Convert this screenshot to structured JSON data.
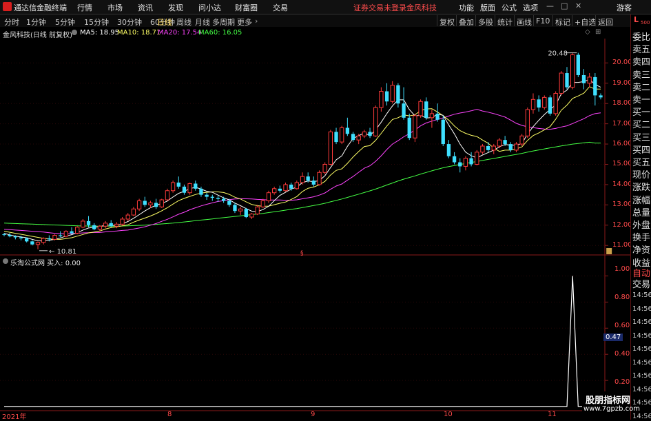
{
  "menubar": {
    "app_name": "通达信金融终端",
    "items": [
      "行情",
      "市场",
      "资讯",
      "发现",
      "问小达",
      "财富圈",
      "交易"
    ],
    "warning": "证券交易未登录",
    "company": "金风科技",
    "right_items": [
      "功能",
      "版面",
      "公式",
      "选项"
    ],
    "guest": "游客",
    "window_buttons": [
      "—",
      "□",
      "✕"
    ]
  },
  "periodbar": {
    "periods": [
      "分时",
      "1分钟",
      "5分钟",
      "15分钟",
      "30分钟",
      "60分钟",
      "日线",
      "周线",
      "月线",
      "多周期",
      "更多"
    ],
    "active": "日线",
    "tools": [
      "复权",
      "叠加",
      "多股",
      "统计",
      "画线",
      "F10",
      "标记",
      "+自选",
      "返回"
    ]
  },
  "chart_header": {
    "title": "金风科技(日线 前复权)",
    "ma5_label": "MA5: 18.95",
    "ma10_label": "MA10: 18.71",
    "ma20_label": "MA20: 17.54",
    "ma60_label": "MA60: 16.05",
    "colors": {
      "ma5": "#ffffff",
      "ma10": "#ffff66",
      "ma20": "#ff44ff",
      "ma60": "#44ff44"
    }
  },
  "indicator_header": {
    "title": "乐淘公式网 买入: 0.00"
  },
  "right_panel": {
    "top_tag": "L",
    "top_sub": "500",
    "items": [
      "委比",
      "卖五",
      "卖四",
      "卖三",
      "卖二",
      "卖一",
      "买一",
      "买二",
      "买三",
      "买四",
      "买五",
      "现价",
      "涨跌",
      "涨幅",
      "总量",
      "外盘",
      "换手",
      "净资",
      "收益"
    ],
    "bottom_items": [
      "自动",
      "交易"
    ],
    "times": [
      "14:56",
      "14:56",
      "14:56",
      "14:56",
      "14:56",
      "14:56",
      "14:56",
      "14:56",
      "14:56",
      "14:56"
    ]
  },
  "price_axis": [
    "20.00",
    "19.00",
    "18.00",
    "17.00",
    "16.00",
    "15.00",
    "14.00",
    "13.00",
    "12.00",
    "11.00"
  ],
  "indicator_axis": [
    "1.00",
    "0.80",
    "0.60",
    "0.47",
    "0.40",
    "0.20"
  ],
  "date_axis": [
    "2021年",
    "8",
    "9",
    "10",
    "11"
  ],
  "annotations": {
    "high": "20.48",
    "low": "10.81"
  },
  "watermark": {
    "line1": "股朋指标网",
    "line2": "www.7gpzb.com"
  },
  "chart_data": {
    "type": "candlestick",
    "title": "金风科技(日线 前复权)",
    "ylim": [
      10.6,
      21.2
    ],
    "indicator_ylim": [
      0,
      1.05
    ],
    "months_index": {
      "2021年": 0,
      "8": 38,
      "9": 72,
      "10": 101,
      "11": 119
    },
    "candles": [
      [
        11.55,
        11.62,
        11.45,
        11.52
      ],
      [
        11.52,
        11.62,
        11.4,
        11.45
      ],
      [
        11.45,
        11.5,
        11.3,
        11.4
      ],
      [
        11.4,
        11.48,
        11.25,
        11.35
      ],
      [
        11.35,
        11.4,
        11.15,
        11.2
      ],
      [
        11.2,
        11.25,
        11.0,
        11.05
      ],
      [
        11.05,
        11.2,
        10.81,
        11.15
      ],
      [
        11.15,
        11.4,
        11.05,
        11.35
      ],
      [
        11.35,
        11.5,
        11.2,
        11.3
      ],
      [
        11.3,
        11.55,
        11.25,
        11.5
      ],
      [
        11.5,
        11.7,
        11.4,
        11.45
      ],
      [
        11.45,
        11.75,
        11.4,
        11.7
      ],
      [
        11.7,
        11.9,
        11.55,
        11.6
      ],
      [
        11.6,
        11.95,
        11.55,
        11.9
      ],
      [
        11.9,
        12.3,
        11.85,
        12.2
      ],
      [
        12.2,
        12.45,
        11.9,
        12.0
      ],
      [
        12.0,
        12.1,
        11.75,
        11.8
      ],
      [
        11.8,
        12.0,
        11.7,
        11.95
      ],
      [
        11.95,
        12.2,
        11.85,
        12.1
      ],
      [
        12.1,
        12.25,
        11.9,
        11.95
      ],
      [
        11.95,
        12.15,
        11.85,
        12.05
      ],
      [
        12.05,
        12.4,
        12.0,
        12.3
      ],
      [
        12.3,
        12.6,
        12.2,
        12.5
      ],
      [
        12.5,
        12.9,
        12.45,
        12.8
      ],
      [
        12.8,
        13.3,
        12.7,
        13.2
      ],
      [
        13.2,
        13.4,
        12.9,
        13.0
      ],
      [
        13.0,
        13.2,
        12.85,
        13.1
      ],
      [
        13.1,
        13.3,
        12.8,
        12.9
      ],
      [
        12.9,
        13.3,
        12.85,
        13.25
      ],
      [
        13.25,
        13.8,
        13.2,
        13.7
      ],
      [
        13.7,
        14.2,
        13.6,
        14.1
      ],
      [
        14.1,
        14.4,
        13.8,
        13.9
      ],
      [
        13.9,
        14.0,
        13.5,
        13.6
      ],
      [
        13.6,
        14.1,
        13.5,
        14.05
      ],
      [
        14.05,
        14.2,
        13.7,
        13.8
      ],
      [
        13.8,
        13.9,
        13.4,
        13.5
      ],
      [
        13.5,
        13.6,
        13.25,
        13.4
      ],
      [
        13.4,
        13.5,
        13.2,
        13.35
      ],
      [
        13.35,
        13.45,
        13.15,
        13.3
      ],
      [
        13.3,
        13.4,
        13.1,
        13.2
      ],
      [
        13.2,
        13.3,
        12.9,
        13.0
      ],
      [
        13.0,
        13.1,
        12.6,
        12.7
      ],
      [
        12.7,
        12.9,
        12.5,
        12.8
      ],
      [
        12.8,
        12.85,
        12.35,
        12.4
      ],
      [
        12.4,
        12.6,
        12.3,
        12.55
      ],
      [
        12.55,
        13.0,
        12.5,
        12.9
      ],
      [
        12.9,
        13.3,
        12.85,
        13.2
      ],
      [
        13.2,
        13.7,
        13.1,
        13.6
      ],
      [
        13.6,
        13.9,
        13.5,
        13.8
      ],
      [
        13.8,
        13.95,
        13.6,
        13.7
      ],
      [
        13.7,
        14.1,
        13.65,
        14.0
      ],
      [
        14.0,
        14.1,
        13.7,
        13.8
      ],
      [
        13.8,
        14.2,
        13.75,
        14.1
      ],
      [
        14.1,
        14.6,
        14.0,
        14.4
      ],
      [
        14.4,
        14.6,
        14.1,
        14.2
      ],
      [
        14.2,
        14.4,
        13.9,
        14.0
      ],
      [
        14.0,
        14.7,
        13.95,
        14.6
      ],
      [
        14.6,
        15.1,
        14.5,
        15.0
      ],
      [
        15.0,
        16.7,
        14.95,
        16.6
      ],
      [
        16.6,
        16.8,
        16.0,
        16.1
      ],
      [
        16.1,
        16.9,
        16.0,
        16.8
      ],
      [
        16.8,
        17.3,
        16.4,
        16.5
      ],
      [
        16.5,
        16.6,
        16.1,
        16.2
      ],
      [
        16.2,
        16.5,
        16.0,
        16.4
      ],
      [
        16.4,
        16.7,
        16.3,
        16.6
      ],
      [
        16.6,
        16.8,
        16.3,
        16.4
      ],
      [
        16.4,
        17.9,
        16.35,
        17.8
      ],
      [
        17.8,
        18.8,
        17.6,
        18.6
      ],
      [
        18.6,
        19.0,
        17.9,
        18.1
      ],
      [
        18.1,
        19.1,
        18.0,
        18.9
      ],
      [
        18.9,
        19.0,
        17.8,
        18.0
      ],
      [
        18.0,
        18.8,
        17.2,
        17.3
      ],
      [
        17.3,
        17.5,
        16.2,
        16.3
      ],
      [
        16.3,
        17.5,
        16.1,
        17.4
      ],
      [
        17.4,
        18.2,
        17.3,
        18.1
      ],
      [
        18.1,
        18.3,
        17.2,
        17.3
      ],
      [
        17.3,
        17.7,
        16.8,
        17.5
      ],
      [
        17.5,
        18.0,
        17.1,
        17.2
      ],
      [
        17.2,
        17.4,
        15.9,
        16.0
      ],
      [
        16.0,
        16.2,
        15.3,
        15.4
      ],
      [
        15.4,
        15.6,
        15.0,
        15.1
      ],
      [
        15.1,
        15.3,
        14.6,
        14.9
      ],
      [
        14.9,
        15.4,
        14.7,
        15.3
      ],
      [
        15.3,
        15.6,
        14.9,
        15.0
      ],
      [
        15.0,
        15.7,
        14.95,
        15.6
      ],
      [
        15.6,
        16.0,
        15.5,
        15.9
      ],
      [
        15.9,
        16.1,
        15.6,
        15.7
      ],
      [
        15.7,
        16.0,
        15.5,
        15.9
      ],
      [
        15.9,
        16.3,
        15.8,
        16.2
      ],
      [
        16.2,
        16.4,
        15.9,
        16.0
      ],
      [
        16.0,
        16.1,
        15.6,
        15.7
      ],
      [
        15.7,
        16.1,
        15.6,
        16.0
      ],
      [
        16.0,
        16.5,
        15.9,
        16.4
      ],
      [
        16.4,
        17.8,
        16.3,
        17.7
      ],
      [
        17.7,
        18.5,
        17.5,
        18.2
      ],
      [
        18.2,
        18.4,
        17.6,
        17.8
      ],
      [
        17.8,
        18.4,
        17.7,
        18.3
      ],
      [
        18.3,
        18.4,
        17.4,
        17.5
      ],
      [
        17.5,
        18.6,
        17.4,
        18.5
      ],
      [
        18.5,
        19.6,
        18.4,
        19.5
      ],
      [
        19.5,
        19.8,
        18.7,
        18.8
      ],
      [
        18.8,
        20.48,
        18.7,
        20.4
      ],
      [
        20.4,
        20.5,
        19.3,
        19.4
      ],
      [
        19.4,
        19.7,
        18.7,
        19.0
      ],
      [
        19.0,
        19.5,
        18.8,
        19.3
      ],
      [
        19.3,
        19.5,
        17.9,
        18.4
      ],
      [
        18.4,
        18.5,
        18.2,
        18.3
      ]
    ],
    "ma5": [
      11.6,
      11.52,
      11.46,
      11.42,
      11.38,
      11.3,
      11.23,
      11.22,
      11.26,
      11.3,
      11.37,
      11.46,
      11.53,
      11.63,
      11.76,
      11.86,
      11.9,
      11.93,
      12.0,
      12.0,
      11.98,
      12.07,
      12.18,
      12.34,
      12.52,
      12.7,
      12.86,
      12.98,
      13.07,
      13.19,
      13.39,
      13.57,
      13.67,
      13.8,
      13.87,
      13.78,
      13.67,
      13.62,
      13.48,
      13.35,
      13.25,
      13.09,
      12.96,
      12.82,
      12.69,
      12.67,
      12.77,
      12.93,
      13.21,
      13.47,
      13.62,
      13.78,
      13.88,
      14.1,
      14.18,
      14.14,
      14.2,
      14.44,
      14.84,
      15.22,
      15.42,
      15.89,
      16.27,
      16.42,
      16.54,
      16.42,
      16.7,
      17.08,
      17.5,
      17.88,
      18.18,
      18.18,
      17.7,
      17.39,
      17.42,
      17.28,
      17.31,
      17.47,
      17.42,
      16.94,
      16.5,
      16.0,
      15.6,
      15.42,
      15.32,
      15.46,
      15.58,
      15.7,
      15.86,
      15.98,
      15.94,
      15.95,
      16.02,
      16.5,
      16.86,
      17.17,
      17.46,
      17.7,
      17.94,
      18.48,
      18.66,
      19.04,
      19.04,
      19.08,
      19.18,
      18.94,
      18.8
    ],
    "ma10": [
      11.7,
      11.65,
      11.6,
      11.55,
      11.5,
      11.45,
      11.4,
      11.35,
      11.32,
      11.3,
      11.3,
      11.34,
      11.38,
      11.46,
      11.54,
      11.62,
      11.66,
      11.71,
      11.81,
      11.88,
      11.92,
      11.97,
      12.02,
      12.15,
      12.25,
      12.35,
      12.45,
      12.57,
      12.71,
      12.86,
      13.04,
      13.21,
      13.32,
      13.42,
      13.51,
      13.58,
      13.62,
      13.64,
      13.64,
      13.61,
      13.52,
      13.38,
      13.29,
      13.15,
      13.02,
      12.96,
      12.93,
      12.94,
      13.01,
      13.08,
      13.14,
      13.27,
      13.41,
      13.66,
      13.82,
      13.88,
      13.99,
      14.16,
      14.47,
      14.7,
      14.78,
      15.05,
      15.36,
      15.63,
      15.88,
      15.92,
      16.18,
      16.53,
      16.89,
      17.21,
      17.3,
      17.44,
      17.39,
      17.44,
      17.65,
      17.73,
      17.74,
      17.58,
      17.4,
      17.18,
      16.89,
      16.66,
      16.53,
      16.43,
      16.37,
      16.2,
      16.04,
      15.8,
      15.64,
      15.7,
      15.7,
      15.76,
      15.86,
      16.18,
      16.42,
      16.55,
      16.7,
      16.86,
      17.22,
      17.67,
      17.92,
      18.25,
      18.37,
      18.51,
      18.83,
      18.71,
      18.71
    ],
    "ma20": [
      11.8,
      11.78,
      11.76,
      11.74,
      11.72,
      11.7,
      11.68,
      11.66,
      11.63,
      11.6,
      11.58,
      11.58,
      11.58,
      11.6,
      11.62,
      11.63,
      11.64,
      11.64,
      11.67,
      11.69,
      11.71,
      11.74,
      11.76,
      11.81,
      11.86,
      11.92,
      12.0,
      12.08,
      12.19,
      12.29,
      12.41,
      12.54,
      12.64,
      12.76,
      12.86,
      12.95,
      13.03,
      13.1,
      13.17,
      13.21,
      13.26,
      13.29,
      13.3,
      13.3,
      13.29,
      13.27,
      13.26,
      13.24,
      13.24,
      13.24,
      13.23,
      13.23,
      13.25,
      13.3,
      13.35,
      13.4,
      13.48,
      13.59,
      13.77,
      13.93,
      14.03,
      14.22,
      14.4,
      14.61,
      14.81,
      14.93,
      15.15,
      15.42,
      15.73,
      16.0,
      16.17,
      16.36,
      16.51,
      16.69,
      16.9,
      17.04,
      17.13,
      17.21,
      17.29,
      17.38,
      17.47,
      17.53,
      17.58,
      17.64,
      17.71,
      17.63,
      17.57,
      17.5,
      17.42,
      17.33,
      17.18,
      17.02,
      16.92,
      16.85,
      16.81,
      16.77,
      16.74,
      16.73,
      16.77,
      16.84,
      16.9,
      17.01,
      17.13,
      17.25,
      17.4,
      17.5,
      17.54
    ],
    "ma60": [
      12.1,
      12.09,
      12.08,
      12.07,
      12.06,
      12.05,
      12.04,
      12.03,
      12.02,
      12.01,
      12.0,
      11.99,
      11.98,
      11.97,
      11.96,
      11.96,
      11.95,
      11.95,
      11.95,
      11.95,
      11.95,
      11.96,
      11.97,
      11.98,
      11.99,
      12.0,
      12.02,
      12.04,
      12.06,
      12.08,
      12.1,
      12.13,
      12.16,
      12.19,
      12.22,
      12.25,
      12.28,
      12.31,
      12.34,
      12.37,
      12.4,
      12.43,
      12.46,
      12.49,
      12.52,
      12.55,
      12.58,
      12.62,
      12.66,
      12.7,
      12.74,
      12.78,
      12.82,
      12.87,
      12.92,
      12.97,
      13.02,
      13.08,
      13.15,
      13.22,
      13.29,
      13.37,
      13.45,
      13.53,
      13.61,
      13.69,
      13.78,
      13.88,
      13.98,
      14.08,
      14.18,
      14.27,
      14.35,
      14.43,
      14.52,
      14.6,
      14.68,
      14.76,
      14.83,
      14.89,
      14.94,
      14.99,
      15.04,
      15.09,
      15.14,
      15.19,
      15.24,
      15.29,
      15.34,
      15.39,
      15.44,
      15.49,
      15.54,
      15.6,
      15.66,
      15.71,
      15.76,
      15.81,
      15.86,
      15.91,
      15.95,
      16.0,
      16.03,
      16.06,
      16.09,
      16.05,
      16.05
    ],
    "buy_signal": {
      "index": 101,
      "value": 1.0,
      "current": 0.0
    }
  }
}
